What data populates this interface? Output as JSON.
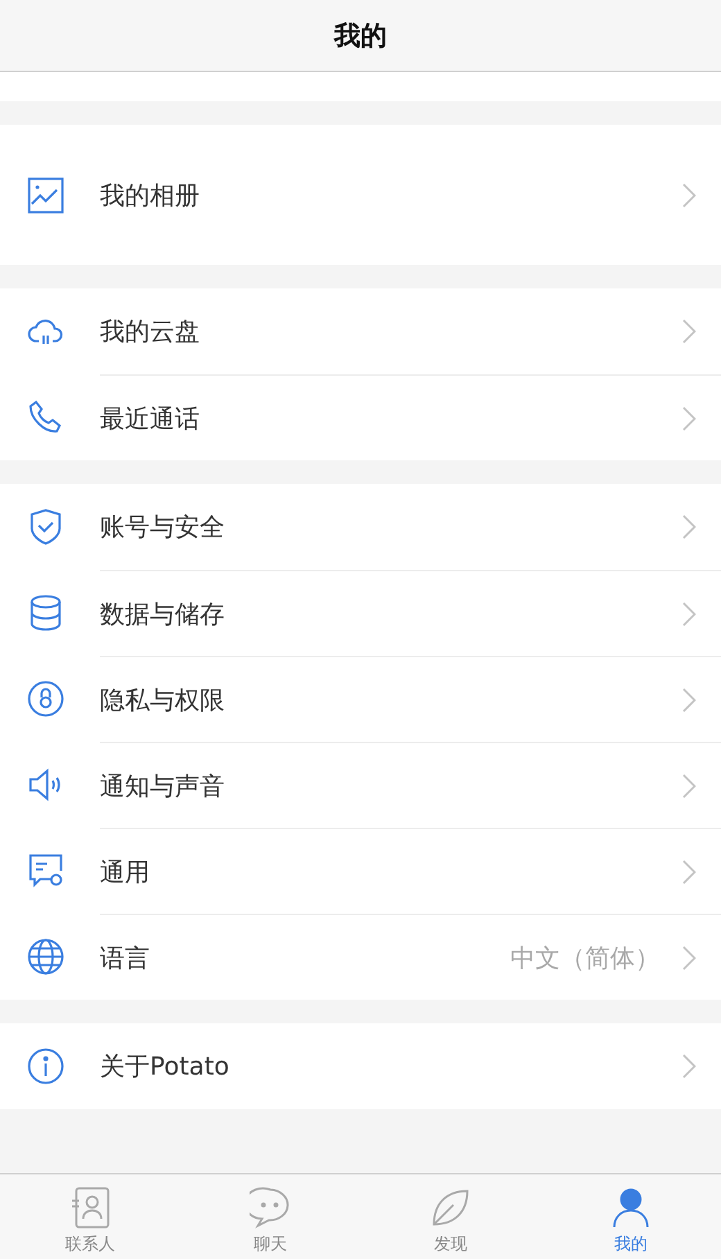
{
  "header": {
    "title": "我的"
  },
  "groups": [
    {
      "items": [
        {
          "label": "我的相册"
        }
      ]
    },
    {
      "items": [
        {
          "label": "我的云盘"
        },
        {
          "label": "最近通话"
        }
      ]
    },
    {
      "items": [
        {
          "label": "账号与安全"
        },
        {
          "label": "数据与储存"
        },
        {
          "label": "隐私与权限"
        },
        {
          "label": "通知与声音"
        },
        {
          "label": "通用"
        },
        {
          "label": "语言",
          "value": "中文（简体）"
        }
      ]
    },
    {
      "items": [
        {
          "label": "关于Potato"
        }
      ]
    }
  ],
  "tabs": [
    {
      "label": "联系人",
      "selected": false
    },
    {
      "label": "聊天",
      "selected": false
    },
    {
      "label": "发现",
      "selected": false
    },
    {
      "label": "我的",
      "selected": true
    }
  ]
}
